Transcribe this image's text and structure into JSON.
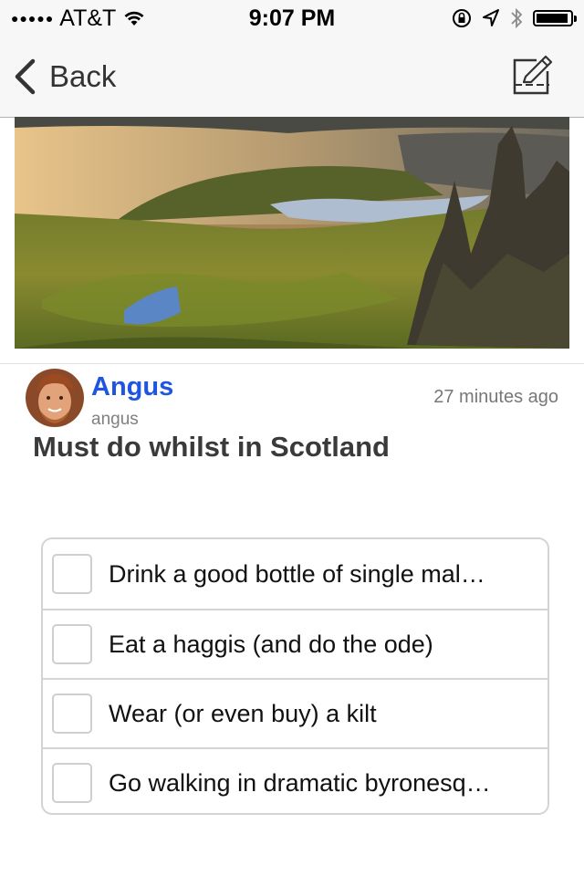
{
  "status_bar": {
    "signal": "●●●●●",
    "carrier": "AT&T",
    "time": "9:07 PM",
    "battery_level": 0.95
  },
  "nav": {
    "back_label": "Back"
  },
  "post": {
    "author_name": "Angus",
    "author_handle": "angus",
    "timestamp": "27 minutes ago",
    "title": "Must do whilst in Scotland"
  },
  "checklist": {
    "items": [
      {
        "label": "Drink a good bottle of single mal…",
        "checked": false
      },
      {
        "label": "Eat a haggis (and do the ode)",
        "checked": false
      },
      {
        "label": "Wear (or even buy) a kilt",
        "checked": false
      },
      {
        "label": "Go walking in dramatic byronesq…",
        "checked": false
      }
    ]
  },
  "colors": {
    "accent": "#1f55e0",
    "nav_background": "#f7f7f7",
    "border": "#d4d4d4"
  },
  "icons": {
    "back": "chevron-left-icon",
    "compose": "compose-icon",
    "wifi": "wifi-icon",
    "lock": "orientation-lock-icon",
    "location": "location-arrow-icon",
    "bluetooth": "bluetooth-icon",
    "battery": "battery-icon"
  }
}
